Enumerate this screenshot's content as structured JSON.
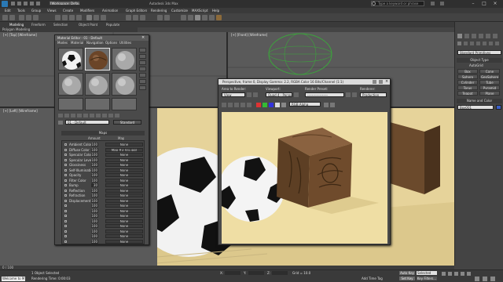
{
  "app": {
    "title": "[Workspace: Default]",
    "search_placeholder": "Type a keyword or phrase"
  },
  "menu": [
    "Edit",
    "Tools",
    "Group",
    "Views",
    "Create",
    "Modifiers",
    "Animation",
    "Graph Editors",
    "Rendering",
    "Customize",
    "MAXScript",
    "Help"
  ],
  "ribbon": {
    "tabs": [
      "Modeling",
      "Freeform",
      "Selection",
      "Object Paint",
      "Populate"
    ],
    "sub_label": "Polygon Modeling"
  },
  "viewports": {
    "top_left": "[+] [Top] [Wireframe]",
    "top_right": "[+] [Front] [Wireframe]",
    "bottom_left": "[+] [Left] [Wireframe]"
  },
  "material_editor": {
    "title": "Material Editor - 01 - Default",
    "menu": [
      "Modes",
      "Material",
      "Navigation",
      "Options",
      "Utilities"
    ],
    "material_name": "01 - Default",
    "material_type": "Standard",
    "maps_header": "Maps",
    "col_amount": "Amount",
    "col_map": "Map",
    "maps": [
      {
        "name": "Ambient Color",
        "amount": "100",
        "map": "None"
      },
      {
        "name": "Diffuse Color",
        "amount": "100",
        "map": "Map #3 (01.jpg)"
      },
      {
        "name": "Specular Color",
        "amount": "100",
        "map": "None"
      },
      {
        "name": "Specular Level",
        "amount": "100",
        "map": "None"
      },
      {
        "name": "Glossiness",
        "amount": "100",
        "map": "None"
      },
      {
        "name": "Self-Illumination",
        "amount": "100",
        "map": "None"
      },
      {
        "name": "Opacity",
        "amount": "100",
        "map": "None"
      },
      {
        "name": "Filter Color",
        "amount": "100",
        "map": "None"
      },
      {
        "name": "Bump",
        "amount": "30",
        "map": "None"
      },
      {
        "name": "Reflection",
        "amount": "100",
        "map": "None"
      },
      {
        "name": "Refraction",
        "amount": "100",
        "map": "None"
      },
      {
        "name": "Displacement",
        "amount": "100",
        "map": "None"
      },
      {
        "name": "",
        "amount": "100",
        "map": "None"
      },
      {
        "name": "",
        "amount": "100",
        "map": "None"
      },
      {
        "name": "",
        "amount": "100",
        "map": "None"
      },
      {
        "name": "",
        "amount": "100",
        "map": "None"
      },
      {
        "name": "",
        "amount": "100",
        "map": "None"
      },
      {
        "name": "",
        "amount": "100",
        "map": "None"
      },
      {
        "name": "",
        "amount": "100",
        "map": "None"
      },
      {
        "name": "",
        "amount": "100",
        "map": "None"
      }
    ]
  },
  "render_window": {
    "title": "Perspective, frame 0, Display Gamma: 2.2, RGBA Color 16 Bits/Channel (1:1)",
    "area_label": "Area to Render:",
    "area_value": "View",
    "viewport_label": "Viewport:",
    "viewport_value": "Quad 4 - Perspec",
    "preset_label": "Render Preset:",
    "preset_value": "------------------",
    "renderer_label": "Renderer:",
    "renderer_value": "Production",
    "channel_value": "RGB Alpha"
  },
  "command_panel": {
    "category": "Standard Primitives",
    "object_type_label": "Object Type",
    "autogrid": "AutoGrid",
    "buttons": [
      "Box",
      "Cone",
      "Sphere",
      "GeoSphere",
      "Cylinder",
      "Tube",
      "Torus",
      "Pyramid",
      "Teapot",
      "Plane"
    ],
    "name_color_label": "Name and Color",
    "object_name": "Box001"
  },
  "status": {
    "object_selected": "1 Object Selected",
    "prompt": "Rendering Time: 0:00:03",
    "welcome": "Welcome to M",
    "timeline": "0 / 100",
    "x": "X:",
    "y": "Y:",
    "z": "Z:",
    "grid": "Grid = 10.0",
    "key_mode": "Auto Key",
    "selected_dropdown": "Selected",
    "set_key": "Set Key",
    "key_filters": "Key Filters...",
    "add_time_tag": "Add Time Tag"
  },
  "colors": {
    "accent": "#2a79b5",
    "background_render": "#efdea4",
    "viewport_bg": "#5a5a5a"
  }
}
